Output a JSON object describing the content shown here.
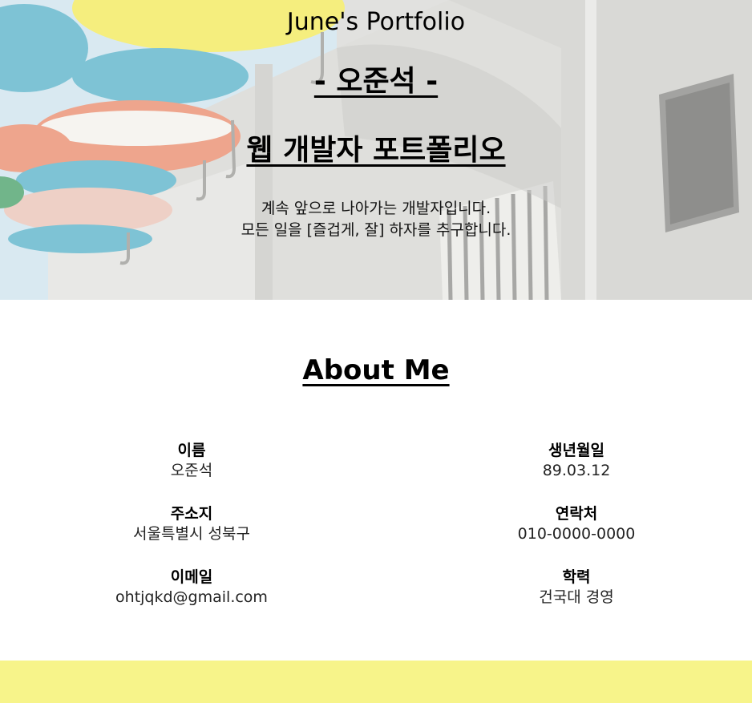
{
  "hero": {
    "site_title": "June's Portfolio",
    "name": "- 오준석 -",
    "heading": "웹 개발자 포트폴리오",
    "desc_line1": "계속 앞으로 나아가는 개발자입니다.",
    "desc_line2": "모든 일을 [즐겁게, 잘] 하자를 추구합니다."
  },
  "about": {
    "title": "About Me",
    "left": [
      {
        "label": "이름",
        "value": "오준석"
      },
      {
        "label": "주소지",
        "value": "서울특별시 성북구"
      },
      {
        "label": "이메일",
        "value": "ohtjqkd@gmail.com"
      }
    ],
    "right": [
      {
        "label": "생년월일",
        "value": "89.03.12"
      },
      {
        "label": "연락처",
        "value": "010-0000-0000"
      },
      {
        "label": "학력",
        "value": "건국대 경영"
      }
    ]
  },
  "colors": {
    "footer_band": "#f7f48a",
    "umbrella_yellow": "#f2ea5a",
    "umbrella_teal": "#5ab3c9",
    "umbrella_coral": "#e98c6d"
  }
}
